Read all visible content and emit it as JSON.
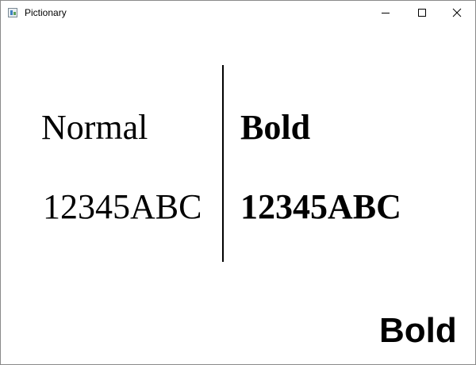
{
  "window": {
    "title": "Pictionary",
    "icon": "app-icon",
    "controls": {
      "minimize_icon": "minimize-icon",
      "maximize_icon": "maximize-icon",
      "close_icon": "close-icon"
    }
  },
  "content": {
    "normal_label": "Normal",
    "bold_label": "Bold",
    "normal_sample": "12345ABC",
    "bold_sample": "12345ABC",
    "sans_bold_label": "Bold"
  },
  "colors": {
    "text": "#000000",
    "background": "#ffffff"
  }
}
